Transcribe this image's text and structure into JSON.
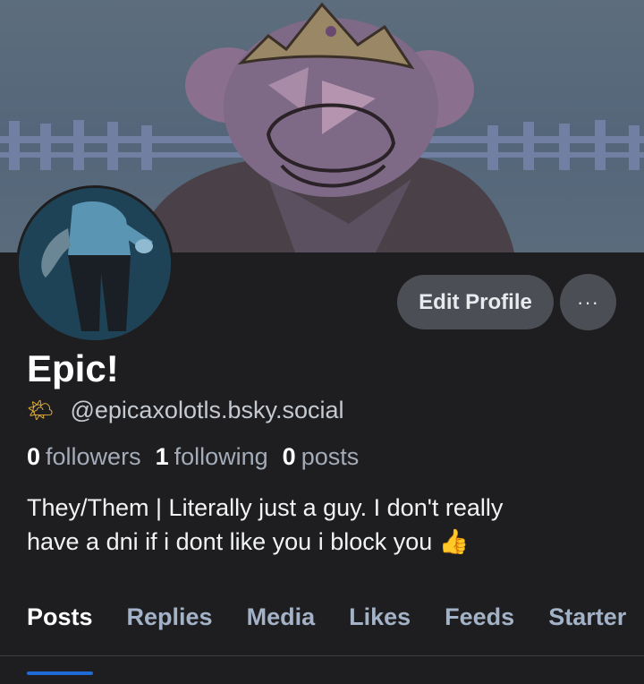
{
  "profile": {
    "display_name": "Epic!",
    "handle_icon": "sun-icon",
    "handle_emoji": "🌤",
    "handle": "@epicaxolotls.bsky.social",
    "stats": {
      "followers_count": "0",
      "followers_label": "followers",
      "following_count": "1",
      "following_label": "following",
      "posts_count": "0",
      "posts_label": "posts"
    },
    "bio_line1": "They/Them | Literally just a guy. I don't really",
    "bio_line2": "have a dni if i dont like you i block you",
    "bio_emoji": "👍"
  },
  "actions": {
    "edit_profile_label": "Edit Profile",
    "more_label": "···"
  },
  "tabs": [
    {
      "label": "Posts",
      "active": true
    },
    {
      "label": "Replies"
    },
    {
      "label": "Media"
    },
    {
      "label": "Likes"
    },
    {
      "label": "Feeds"
    },
    {
      "label": "Starter"
    }
  ],
  "colors": {
    "background": "#1e1e20",
    "accent": "#1f6ad6",
    "button": "#4b4e55"
  }
}
